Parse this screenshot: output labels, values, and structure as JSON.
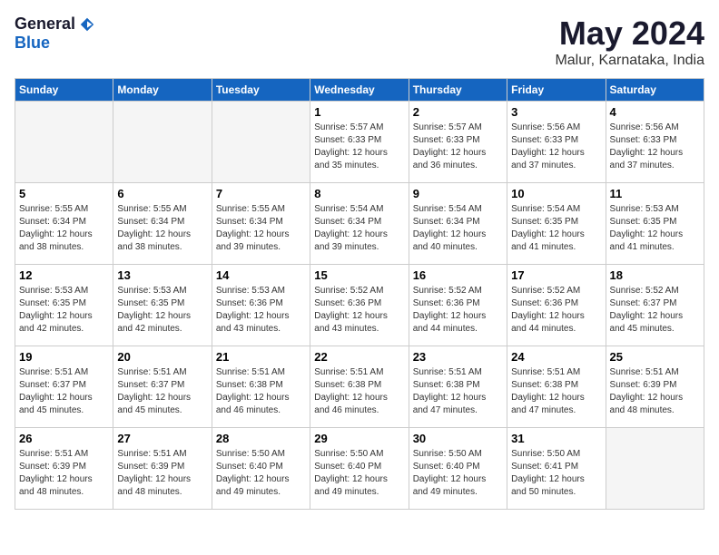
{
  "logo": {
    "general": "General",
    "blue": "Blue"
  },
  "title": {
    "month": "May 2024",
    "location": "Malur, Karnataka, India"
  },
  "headers": [
    "Sunday",
    "Monday",
    "Tuesday",
    "Wednesday",
    "Thursday",
    "Friday",
    "Saturday"
  ],
  "weeks": [
    [
      {
        "day": "",
        "info": ""
      },
      {
        "day": "",
        "info": ""
      },
      {
        "day": "",
        "info": ""
      },
      {
        "day": "1",
        "info": "Sunrise: 5:57 AM\nSunset: 6:33 PM\nDaylight: 12 hours\nand 35 minutes."
      },
      {
        "day": "2",
        "info": "Sunrise: 5:57 AM\nSunset: 6:33 PM\nDaylight: 12 hours\nand 36 minutes."
      },
      {
        "day": "3",
        "info": "Sunrise: 5:56 AM\nSunset: 6:33 PM\nDaylight: 12 hours\nand 37 minutes."
      },
      {
        "day": "4",
        "info": "Sunrise: 5:56 AM\nSunset: 6:33 PM\nDaylight: 12 hours\nand 37 minutes."
      }
    ],
    [
      {
        "day": "5",
        "info": "Sunrise: 5:55 AM\nSunset: 6:34 PM\nDaylight: 12 hours\nand 38 minutes."
      },
      {
        "day": "6",
        "info": "Sunrise: 5:55 AM\nSunset: 6:34 PM\nDaylight: 12 hours\nand 38 minutes."
      },
      {
        "day": "7",
        "info": "Sunrise: 5:55 AM\nSunset: 6:34 PM\nDaylight: 12 hours\nand 39 minutes."
      },
      {
        "day": "8",
        "info": "Sunrise: 5:54 AM\nSunset: 6:34 PM\nDaylight: 12 hours\nand 39 minutes."
      },
      {
        "day": "9",
        "info": "Sunrise: 5:54 AM\nSunset: 6:34 PM\nDaylight: 12 hours\nand 40 minutes."
      },
      {
        "day": "10",
        "info": "Sunrise: 5:54 AM\nSunset: 6:35 PM\nDaylight: 12 hours\nand 41 minutes."
      },
      {
        "day": "11",
        "info": "Sunrise: 5:53 AM\nSunset: 6:35 PM\nDaylight: 12 hours\nand 41 minutes."
      }
    ],
    [
      {
        "day": "12",
        "info": "Sunrise: 5:53 AM\nSunset: 6:35 PM\nDaylight: 12 hours\nand 42 minutes."
      },
      {
        "day": "13",
        "info": "Sunrise: 5:53 AM\nSunset: 6:35 PM\nDaylight: 12 hours\nand 42 minutes."
      },
      {
        "day": "14",
        "info": "Sunrise: 5:53 AM\nSunset: 6:36 PM\nDaylight: 12 hours\nand 43 minutes."
      },
      {
        "day": "15",
        "info": "Sunrise: 5:52 AM\nSunset: 6:36 PM\nDaylight: 12 hours\nand 43 minutes."
      },
      {
        "day": "16",
        "info": "Sunrise: 5:52 AM\nSunset: 6:36 PM\nDaylight: 12 hours\nand 44 minutes."
      },
      {
        "day": "17",
        "info": "Sunrise: 5:52 AM\nSunset: 6:36 PM\nDaylight: 12 hours\nand 44 minutes."
      },
      {
        "day": "18",
        "info": "Sunrise: 5:52 AM\nSunset: 6:37 PM\nDaylight: 12 hours\nand 45 minutes."
      }
    ],
    [
      {
        "day": "19",
        "info": "Sunrise: 5:51 AM\nSunset: 6:37 PM\nDaylight: 12 hours\nand 45 minutes."
      },
      {
        "day": "20",
        "info": "Sunrise: 5:51 AM\nSunset: 6:37 PM\nDaylight: 12 hours\nand 45 minutes."
      },
      {
        "day": "21",
        "info": "Sunrise: 5:51 AM\nSunset: 6:38 PM\nDaylight: 12 hours\nand 46 minutes."
      },
      {
        "day": "22",
        "info": "Sunrise: 5:51 AM\nSunset: 6:38 PM\nDaylight: 12 hours\nand 46 minutes."
      },
      {
        "day": "23",
        "info": "Sunrise: 5:51 AM\nSunset: 6:38 PM\nDaylight: 12 hours\nand 47 minutes."
      },
      {
        "day": "24",
        "info": "Sunrise: 5:51 AM\nSunset: 6:38 PM\nDaylight: 12 hours\nand 47 minutes."
      },
      {
        "day": "25",
        "info": "Sunrise: 5:51 AM\nSunset: 6:39 PM\nDaylight: 12 hours\nand 48 minutes."
      }
    ],
    [
      {
        "day": "26",
        "info": "Sunrise: 5:51 AM\nSunset: 6:39 PM\nDaylight: 12 hours\nand 48 minutes."
      },
      {
        "day": "27",
        "info": "Sunrise: 5:51 AM\nSunset: 6:39 PM\nDaylight: 12 hours\nand 48 minutes."
      },
      {
        "day": "28",
        "info": "Sunrise: 5:50 AM\nSunset: 6:40 PM\nDaylight: 12 hours\nand 49 minutes."
      },
      {
        "day": "29",
        "info": "Sunrise: 5:50 AM\nSunset: 6:40 PM\nDaylight: 12 hours\nand 49 minutes."
      },
      {
        "day": "30",
        "info": "Sunrise: 5:50 AM\nSunset: 6:40 PM\nDaylight: 12 hours\nand 49 minutes."
      },
      {
        "day": "31",
        "info": "Sunrise: 5:50 AM\nSunset: 6:41 PM\nDaylight: 12 hours\nand 50 minutes."
      },
      {
        "day": "",
        "info": ""
      }
    ]
  ]
}
